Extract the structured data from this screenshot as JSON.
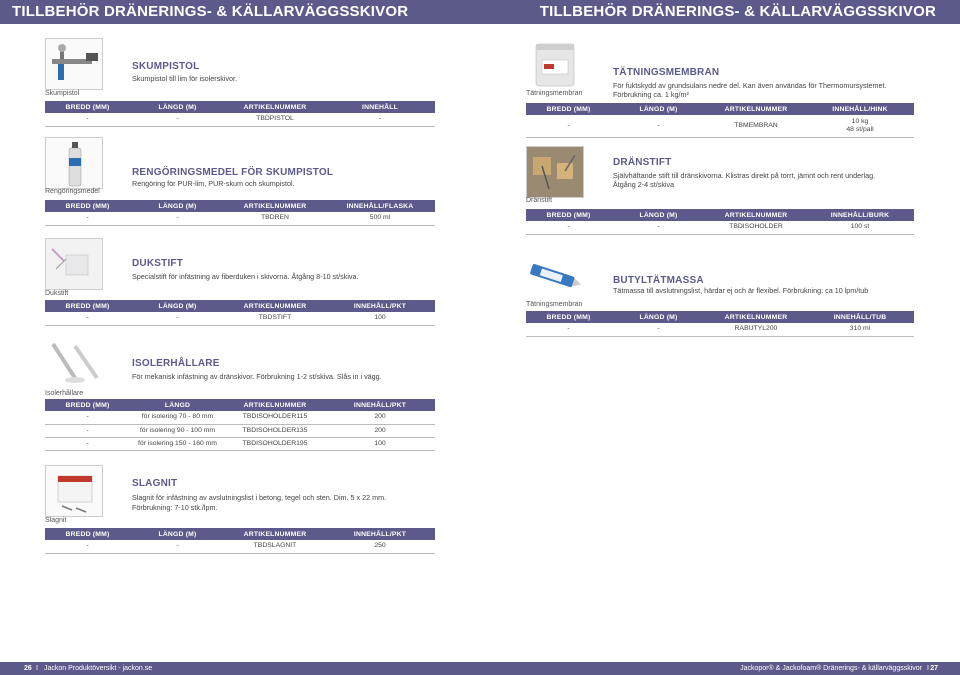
{
  "header": {
    "title_left": "TILLBEHÖR DRÄNERINGS- & KÄLLARVÄGGSSKIVOR",
    "title_right": "TILLBEHÖR DRÄNERINGS- & KÄLLARVÄGGSSKIVOR"
  },
  "footer": {
    "page_left": "26",
    "text_left": "Jackon Produktöversikt - jackon.se",
    "text_right": "Jackopor® & Jackofoam® Dränerings- & källarväggsskivor",
    "page_right": "27"
  },
  "products": {
    "skumpistol": {
      "caption": "Skumpistol",
      "title": "SKUMPISTOL",
      "desc": "Skumpistol till lim för isolerskivor.",
      "headers": [
        "BREDD (MM)",
        "LÄNGD (M)",
        "ARTIKELNUMMER",
        "INNEHÅLL"
      ],
      "rows": [
        [
          "-",
          "-",
          "TBDPISTOL",
          "-"
        ]
      ]
    },
    "rengoring": {
      "caption": "Rengöringsmedel",
      "title": "RENGÖRINGSMEDEL FÖR SKUMPISTOL",
      "desc": "Rengöring för PUR-lim, PUR-skum och skumpistol.",
      "headers": [
        "BREDD (MM)",
        "LÄNGD (M)",
        "ARTIKELNUMMER",
        "INNEHÅLL/FLASKA"
      ],
      "rows": [
        [
          "-",
          "-",
          "TBDREN",
          "500 ml"
        ]
      ]
    },
    "dukstift": {
      "caption": "Dukstift",
      "title": "DUKSTIFT",
      "desc": "Specialstift för infästning av fiberduken i skivorna. Åtgång 8-10 st/skiva.",
      "headers": [
        "BREDD (MM)",
        "LÄNGD (M)",
        "ARTIKELNUMMER",
        "INNEHÅLL/PKT"
      ],
      "rows": [
        [
          "-",
          "-",
          "TBDSTIFT",
          "100"
        ]
      ]
    },
    "isolerhallare": {
      "caption": "Isolerhållare",
      "title": "ISOLERHÅLLARE",
      "desc": "För mekanisk infästning av dränskivor. Förbrukning 1-2 st/skiva. Slås in i vägg.",
      "headers": [
        "BREDD (MM)",
        "LÄNGD",
        "ARTIKELNUMMER",
        "INNEHÅLL/PKT"
      ],
      "rows": [
        [
          "-",
          "för isolering 70 - 80 mm",
          "TBDISOHOLDER115",
          "200"
        ],
        [
          "-",
          "för isolering 90 - 100 mm",
          "TBDISOHOLDER135",
          "200"
        ],
        [
          "-",
          "för isolering 150 - 160 mm",
          "TBDISOHOLDER195",
          "100"
        ]
      ]
    },
    "slagnit": {
      "caption": "Slagnit",
      "title": "SLAGNIT",
      "desc1": "Slagnit för infästning av avslutningslist i betong, tegel och sten. Dim. 5 x 22 mm.",
      "desc2": "Förbrukning: 7-10 stk./lpm.",
      "headers": [
        "BREDD (MM)",
        "LÄNGD (M)",
        "ARTIKELNUMMER",
        "INNEHÅLL/PKT"
      ],
      "rows": [
        [
          "-",
          "-",
          "TBDSLAGNIT",
          "250"
        ]
      ]
    },
    "tatningsmembran": {
      "caption": "Tätningsmembran",
      "title": "TÄTNINGSMEMBRAN",
      "desc1": "För fuktskydd av grundsulans nedre del. Kan även användas för Thermomursystemet.",
      "desc2": "Förbrukning ca. 1 kg/m²",
      "headers": [
        "BREDD (MM)",
        "LÄNGD (M)",
        "ARTIKELNUMMER",
        "INNEHÅLL/HINK"
      ],
      "rows": [
        [
          "-",
          "-",
          "TBMEMBRAN",
          "10 kg",
          "48 st/pall"
        ]
      ]
    },
    "dranstift": {
      "caption": "Dränstift",
      "title": "DRÄNSTIFT",
      "desc1": "Självhäftande stift till dränskivorna. Klistras direkt på torrt, jämnt och rent underlag.",
      "desc2": "Åtgång 2-4 st/skiva",
      "headers": [
        "BREDD (MM)",
        "LÄNGD (M)",
        "ARTIKELNUMMER",
        "INNEHÅLL/BURK"
      ],
      "rows": [
        [
          "-",
          "-",
          "TBDISOHOLDER",
          "100 st"
        ]
      ]
    },
    "butyl": {
      "caption": "Tätningsmembran",
      "title": "BUTYLTÄTMASSA",
      "desc": "Tätmassa till avslutningslist, härdar ej och är flexibel. Förbrukning: ca 10 lpm/tub",
      "headers": [
        "BREDD (MM)",
        "LÄNGD (M)",
        "ARTIKELNUMMER",
        "INNEHÅLL/TUB"
      ],
      "rows": [
        [
          "-",
          "-",
          "RABUTYL200",
          "310 ml"
        ]
      ]
    }
  },
  "colors": {
    "brand": "#5c5a8a"
  }
}
